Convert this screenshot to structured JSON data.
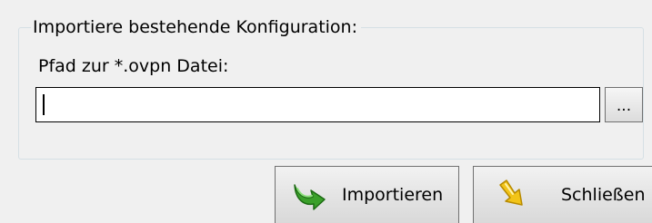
{
  "import_group": {
    "title": "Importiere bestehende Konfiguration:",
    "path_label": "Pfad zur *.ovpn Datei:",
    "path_value": "",
    "browse_label": "..."
  },
  "buttons": {
    "import_label": "Importieren",
    "import_icon": "green-curved-arrow-icon",
    "close_label": "Schließen",
    "close_icon": "yellow-arrow-icon"
  },
  "colors": {
    "window_background": "#f0f0f0",
    "import_icon": "#3aa02a",
    "close_icon": "#f2c418"
  }
}
